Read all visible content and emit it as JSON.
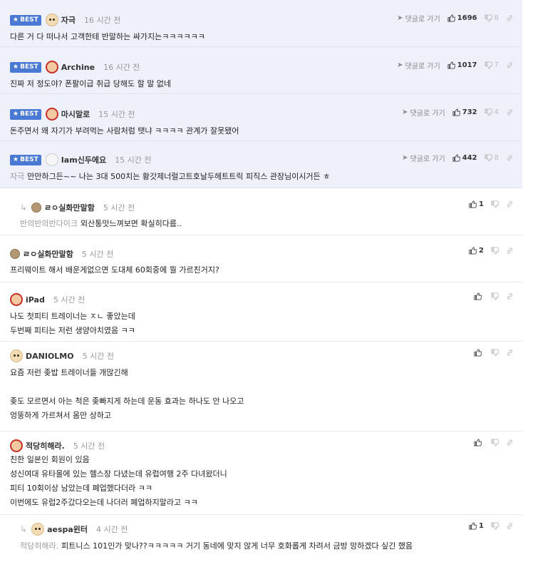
{
  "labels": {
    "best": "BEST",
    "reply_to": "댓글로 가기"
  },
  "best_comments": [
    {
      "author": "자극",
      "avatar": "dog",
      "time": "16 시간 전",
      "text": "다른 거 다 떠나서 고객한테 반말하는 싸가지는ㅋㅋㅋㅋㅋㅋ",
      "likes": "1696",
      "dislikes": "8"
    },
    {
      "author": "Archine",
      "avatar": "red",
      "time": "16 시간 전",
      "text": "진짜 저 정도야? 폰팔이급 취급 당해도 할 말 없네",
      "likes": "1017",
      "dislikes": "7"
    },
    {
      "author": "마시말로",
      "avatar": "red",
      "time": "15 시간 전",
      "text": "돈주면서 왜 자기가 부려먹는 사람처럼 탯냐 ㅋㅋㅋㅋ 관계가 잘못됐어",
      "likes": "732",
      "dislikes": "4"
    },
    {
      "author": "Iam신두에요",
      "avatar": "white",
      "time": "15 시간 전",
      "mention": "자극",
      "text": "만만하그든~~ 나는 3대 500치는 황갓제너럴고트호날두헤트트릭 피직스 관장님이시거든 ㅎ",
      "likes": "442",
      "dislikes": "8"
    }
  ],
  "comments": [
    {
      "reply": true,
      "author": "ㄹㅇ실화만말함",
      "avatar": "ball",
      "time": "5 시간 전",
      "mention": "반의반의반다이크",
      "text": "외산통맛느껴보면 확실히다름..",
      "likes": "1"
    },
    {
      "reply": false,
      "author": "ㄹㅇ실화만말함",
      "avatar": "ball",
      "time": "5 시간 전",
      "text": "프리웨이트 해서 배운게없으면 도대체 60회중에 뭘 가르친거지?",
      "likes": "2"
    },
    {
      "reply": false,
      "author": "iPad",
      "avatar": "red",
      "time": "5 시간 전",
      "text": "나도 첫피티 트레이너는 ㅈㄴ 좋았는데\n두번째 피티는 저런 생양아치였음 ㅋㅋ",
      "likes": ""
    },
    {
      "reply": false,
      "author": "DANIOLMO",
      "avatar": "dog",
      "time": "5 시간 전",
      "text": "요즘 저런 좆밥 트레이너들 개많긴해\n\n좆도 모르면서 아는 척은 좆빠지게 하는데 운동 효과는 하나도 안 나오고\n엉뚱하게 가르쳐서 몸만 상하고",
      "likes": ""
    },
    {
      "reply": false,
      "author": "적당히해라.",
      "avatar": "red",
      "time": "5 시간 전",
      "text": "친한 일본인 회원이 있음\n성신여대 유타몰에 있는 헬스장 다녔는데 유럽여행 2주 다녀왔더니\n피티 10회이상 남았는데 폐업했다더라 ㅋㅋ\n이번에도 유럽2주갔다오는데 나더러 폐업하지말라고 ㅋㅋ",
      "likes": ""
    },
    {
      "reply": true,
      "author": "aespa윈터",
      "avatar": "dog",
      "time": "4 시간 전",
      "mention": "적당히해라.",
      "text": "피트니스 101인가 맞나??ㅋㅋㅋㅋㅋ 거기 동네에 맞지 않게 너무 호화롭게 차려서 금방 망하겠다 싶긴 했음",
      "likes": "1"
    }
  ]
}
